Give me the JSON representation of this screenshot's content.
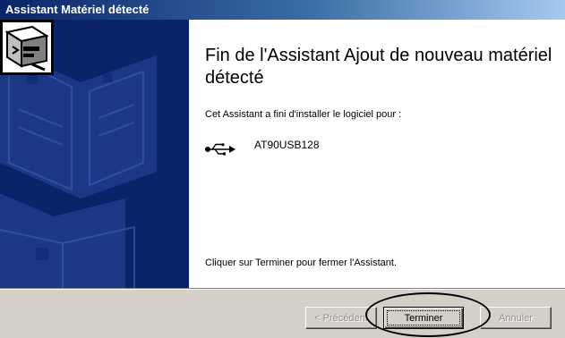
{
  "window": {
    "title": "Assistant Matériel détecté"
  },
  "wizard": {
    "heading": "Fin de l'Assistant Ajout de nouveau matériel détecté",
    "install_message": "Cet Assistant a fini d'installer le logiciel pour :",
    "device_name": "AT90USB128",
    "device_icon": "usb-icon",
    "close_instruction": "Cliquer sur Terminer pour fermer l'Assistant."
  },
  "buttons": {
    "back_label": "< Précédent",
    "back_state": "disabled",
    "finish_label": "Terminer",
    "finish_state": "default-focused",
    "cancel_label": "Annuler",
    "cancel_state": "disabled"
  },
  "colors": {
    "titlebar_start": "#0a246a",
    "titlebar_end": "#a6caf0",
    "banner": "#0a246a",
    "dialog_face": "#d4d0c8"
  }
}
